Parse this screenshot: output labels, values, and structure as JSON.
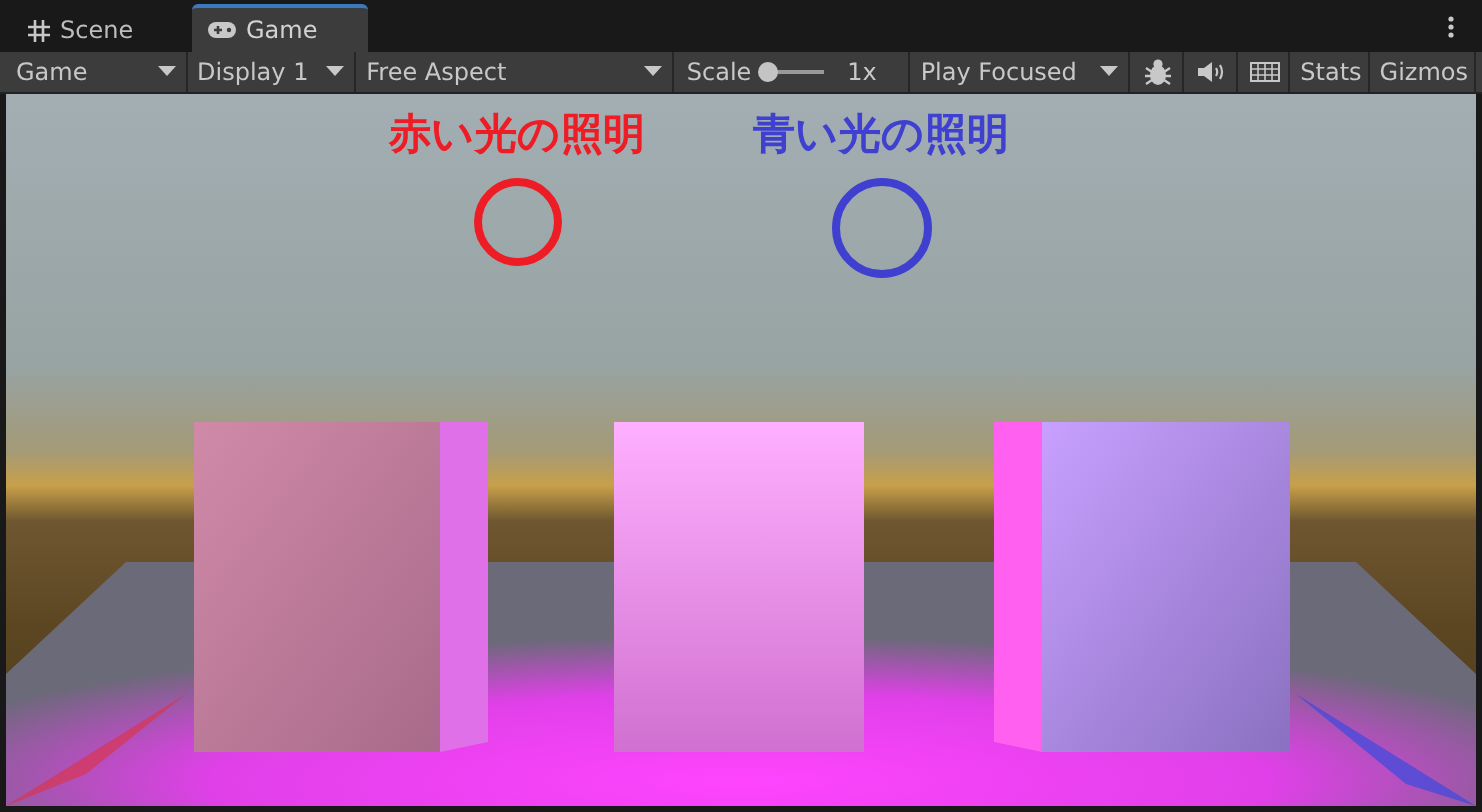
{
  "tabs": [
    {
      "label": "Scene",
      "kind": "grid",
      "selected": false
    },
    {
      "label": "Game",
      "kind": "gamepad",
      "selected": true
    }
  ],
  "toolbar": {
    "dropdowns": [
      {
        "label": "Game"
      },
      {
        "label": "Display 1"
      },
      {
        "label": "Free Aspect"
      }
    ],
    "scale": {
      "label": "Scale",
      "level": 0,
      "reading": "1x"
    },
    "play_mode": {
      "label": "Play Focused"
    },
    "buttons": [
      {
        "label": "Stats"
      },
      {
        "label": "Gizmos"
      }
    ]
  },
  "annotations": [
    {
      "label": "赤い光の照明",
      "color": "#ee1c24"
    },
    {
      "label": "青い光の照明",
      "color": "#4040d0"
    }
  ]
}
